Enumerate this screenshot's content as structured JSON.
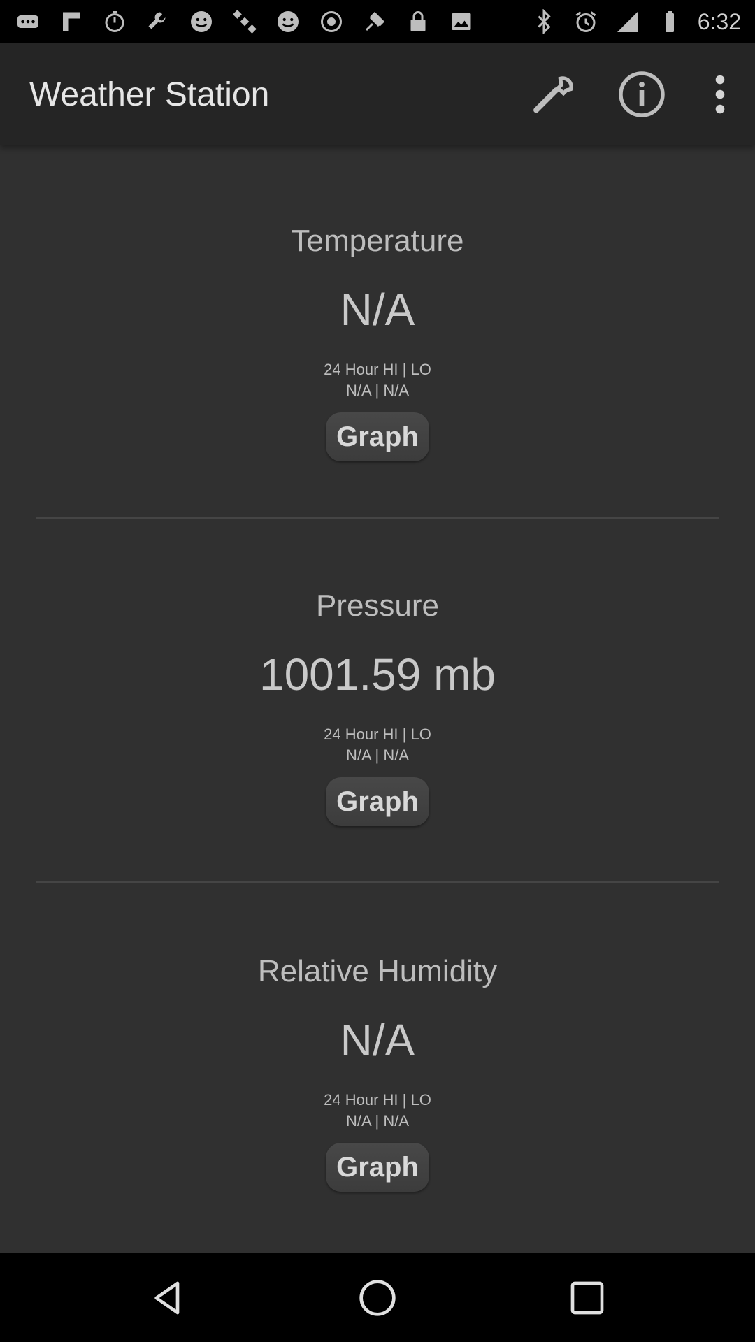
{
  "status_bar": {
    "time": "6:32",
    "left_icons": [
      "more-notifications-icon",
      "pin-icon",
      "stopwatch-icon",
      "wrench-icon",
      "smiley-icon",
      "satellite-icon",
      "smiley-icon",
      "alarm-off-icon",
      "satellite-gps-icon",
      "lock-icon",
      "image-icon"
    ],
    "right_icons": [
      "bluetooth-icon",
      "alarm-icon",
      "cellular-signal-icon",
      "battery-icon"
    ]
  },
  "app_bar": {
    "title": "Weather Station",
    "actions": [
      "wrench-icon",
      "info-icon",
      "overflow-menu-icon"
    ]
  },
  "sensors": [
    {
      "title": "Temperature",
      "value": "N/A",
      "hilo_label": "24 Hour HI | LO",
      "hilo_values": "N/A | N/A",
      "graph_label": "Graph"
    },
    {
      "title": "Pressure",
      "value": "1001.59 mb",
      "hilo_label": "24 Hour HI | LO",
      "hilo_values": "N/A | N/A",
      "graph_label": "Graph"
    },
    {
      "title": "Relative Humidity",
      "value": "N/A",
      "hilo_label": "24 Hour HI | LO",
      "hilo_values": "N/A | N/A",
      "graph_label": "Graph"
    }
  ],
  "nav_bar": {
    "buttons": [
      "back-icon",
      "home-icon",
      "recents-icon"
    ]
  },
  "colors": {
    "background": "#303030",
    "app_bar": "#252525",
    "text": "#c8c8c8"
  }
}
